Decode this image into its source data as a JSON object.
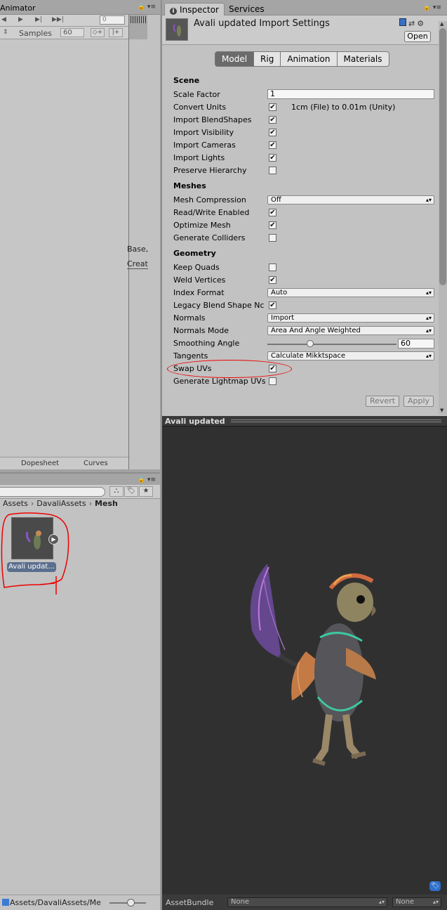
{
  "animator": {
    "title": "Animator",
    "time_value": "0",
    "samples_label": "Samples",
    "samples_value": "60",
    "cut_text_1": "Base,",
    "cut_text_2": "Create",
    "tab_dopesheet": "Dopesheet",
    "tab_curves": "Curves"
  },
  "project": {
    "breadcrumb": [
      "Assets",
      "DavaliAssets",
      "Mesh"
    ],
    "asset_label": "Avali updat...",
    "status_path": "Assets/DavaliAssets/Me"
  },
  "inspector": {
    "tabs": [
      "Inspector",
      "Services"
    ],
    "title": "Avali updated Import Settings",
    "open_label": "Open",
    "segments": [
      "Model",
      "Rig",
      "Animation",
      "Materials"
    ],
    "active_segment": "Model",
    "sections": {
      "scene": "Scene",
      "meshes": "Meshes",
      "geometry": "Geometry"
    },
    "scene": {
      "scale_factor_label": "Scale Factor",
      "scale_factor_value": "1",
      "convert_units_label": "Convert Units",
      "convert_units_note": "1cm (File) to 0.01m (Unity)",
      "import_blendshapes_label": "Import BlendShapes",
      "import_visibility_label": "Import Visibility",
      "import_cameras_label": "Import Cameras",
      "import_lights_label": "Import Lights",
      "preserve_hierarchy_label": "Preserve Hierarchy"
    },
    "meshes": {
      "compression_label": "Mesh Compression",
      "compression_value": "Off",
      "read_write_label": "Read/Write Enabled",
      "optimize_label": "Optimize Mesh",
      "colliders_label": "Generate Colliders"
    },
    "geometry": {
      "keep_quads_label": "Keep Quads",
      "weld_label": "Weld Vertices",
      "index_format_label": "Index Format",
      "index_format_value": "Auto",
      "legacy_blend_label": "Legacy Blend Shape Nc",
      "normals_label": "Normals",
      "normals_value": "Import",
      "normals_mode_label": "Normals Mode",
      "normals_mode_value": "Area And Angle Weighted",
      "smoothing_label": "Smoothing Angle",
      "smoothing_value": "60",
      "tangents_label": "Tangents",
      "tangents_value": "Calculate Mikktspace",
      "swap_uvs_label": "Swap UVs",
      "lightmap_uvs_label": "Generate Lightmap UVs"
    },
    "revert_label": "Revert",
    "apply_label": "Apply"
  },
  "checks": {
    "convert_units": true,
    "import_blendshapes": true,
    "import_visibility": true,
    "import_cameras": true,
    "import_lights": true,
    "preserve_hierarchy": false,
    "read_write": true,
    "optimize_mesh": true,
    "generate_colliders": false,
    "keep_quads": false,
    "weld_vertices": true,
    "legacy_blend": true,
    "swap_uvs": true,
    "lightmap_uvs": false
  },
  "smoothing_fraction": 0.333,
  "preview": {
    "title": "Avali updated",
    "assetbundle_label": "AssetBundle",
    "bundle_value": "None",
    "variant_value": "None"
  },
  "colors": {
    "annotation": "#e00000",
    "active_segment": "#6b6b6b",
    "preview_bg": "#303030"
  }
}
